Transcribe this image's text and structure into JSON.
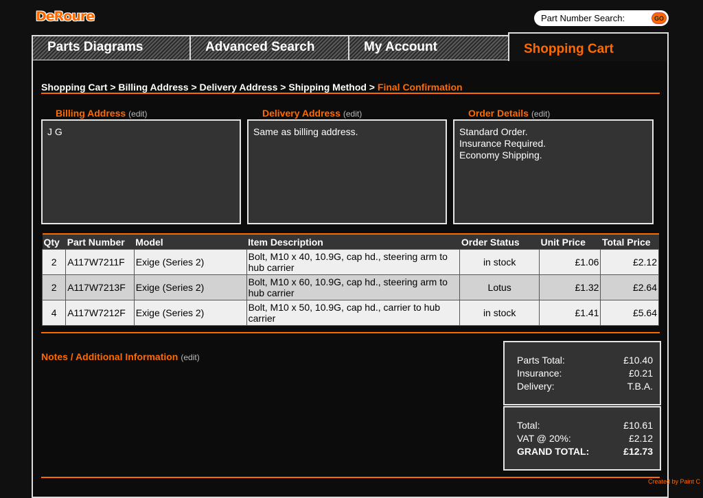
{
  "brand": {
    "logo": "DeRoure"
  },
  "search": {
    "placeholder": "Part Number Search:",
    "go_label": "GO"
  },
  "tabs": [
    {
      "label": "Parts Diagrams",
      "active": false
    },
    {
      "label": "Advanced Search",
      "active": false
    },
    {
      "label": "My Account",
      "active": false
    },
    {
      "label": "Shopping Cart",
      "active": true
    }
  ],
  "breadcrumb": {
    "steps": [
      "Shopping Cart",
      "Billing Address",
      "Delivery Address",
      "Shipping Method"
    ],
    "separator": " > ",
    "current": "Final Confirmation"
  },
  "sections": {
    "billing": {
      "title": "Billing Address",
      "edit": "(edit)",
      "lines": [
        "J G"
      ]
    },
    "delivery": {
      "title": "Delivery Address",
      "edit": "(edit)",
      "lines": [
        "Same as billing address."
      ]
    },
    "order": {
      "title": "Order Details",
      "edit": "(edit)",
      "lines": [
        "Standard Order.",
        "Insurance Required.",
        "Economy Shipping."
      ]
    }
  },
  "table": {
    "headers": [
      "Qty",
      "Part Number",
      "Model",
      "Item Description",
      "Order Status",
      "Unit Price",
      "Total Price"
    ],
    "rows": [
      [
        "2",
        "A117W7211F",
        "Exige (Series 2)",
        "Bolt, M10 x 40, 10.9G, cap hd., steering arm to hub carrier",
        "in stock",
        "£1.06",
        "£2.12"
      ],
      [
        "2",
        "A117W7213F",
        "Exige (Series 2)",
        "Bolt, M10 x 60, 10.9G, cap hd., steering arm to hub carrier",
        "Lotus",
        "£1.32",
        "£2.64"
      ],
      [
        "4",
        "A117W7212F",
        "Exige (Series 2)",
        "Bolt, M10 x 50, 10.9G, cap hd., carrier to hub carrier",
        "in stock",
        "£1.41",
        "£5.64"
      ]
    ]
  },
  "notes": {
    "title": "Notes / Additional Information",
    "edit": "(edit)"
  },
  "totals": {
    "summary": [
      {
        "label": "Parts Total:",
        "value": "£10.40"
      },
      {
        "label": "Insurance:",
        "value": "£0.21"
      },
      {
        "label": "Delivery:",
        "value": "T.B.A."
      }
    ],
    "final": [
      {
        "label": "Total:",
        "value": "£10.61"
      },
      {
        "label": "VAT @ 20%:",
        "value": "£2.12"
      },
      {
        "label": "GRAND TOTAL:",
        "value": "£12.73"
      }
    ]
  },
  "footer": {
    "credit": "Created by Paint C"
  },
  "colors": {
    "accent": "#ff6a00",
    "background": "#101010",
    "box": "#333333"
  }
}
